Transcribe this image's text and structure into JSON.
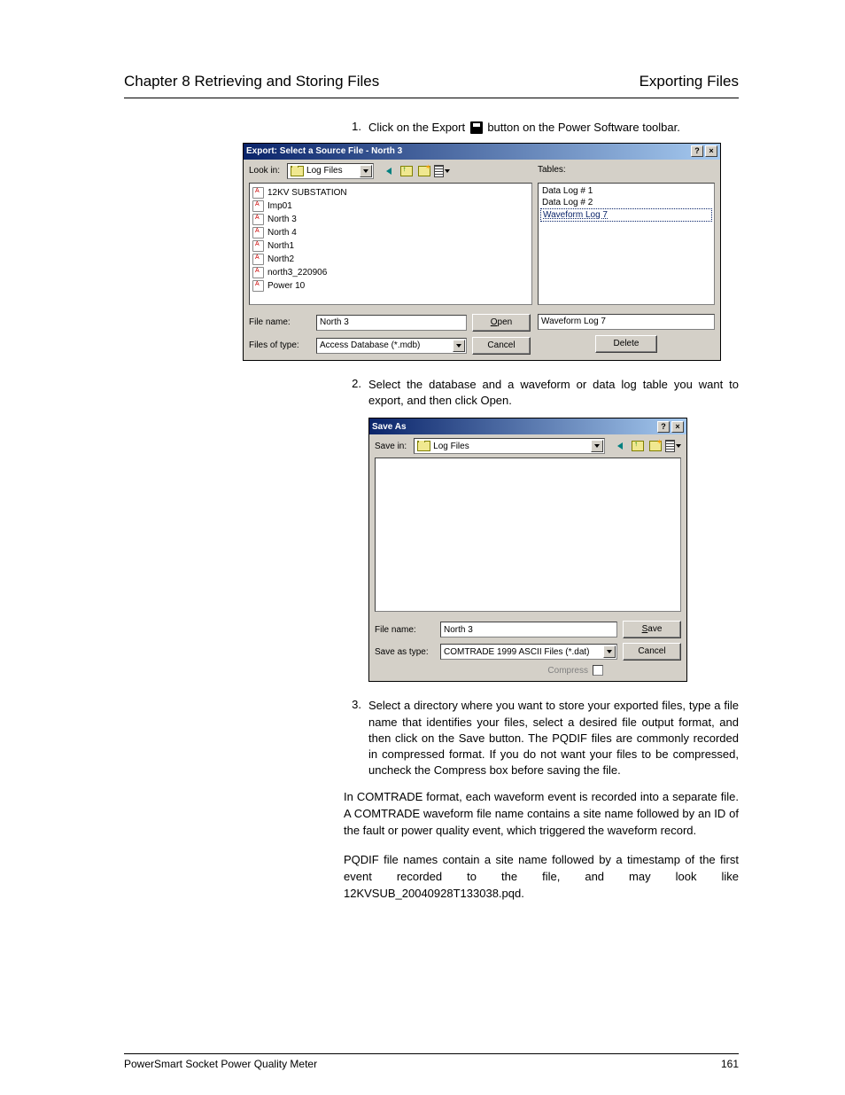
{
  "header": {
    "left": "Chapter 8 Retrieving and Storing Files",
    "right": "Exporting Files"
  },
  "steps": {
    "s1_num": "1.",
    "s1_text_a": "Click on the Export ",
    "s1_text_b": " button on the Power Software toolbar.",
    "s2_num": "2.",
    "s2_text": "Select the database and a waveform or data log table you want to export, and then click Open.",
    "s3_num": "3.",
    "s3_text": "Select a directory where you want to store your exported files, type a file name that identifies your files, select a desired file output format, and then click on the Save button. The PQDIF files are commonly recorded in compressed format. If you do not want your files to be compressed, uncheck the Compress box before saving the file."
  },
  "dialog1": {
    "title": "Export: Select a Source File - North 3",
    "lookin_label": "Look in:",
    "lookin_value": "Log Files",
    "files": [
      "12KV SUBSTATION",
      "Imp01",
      "North 3",
      "North 4",
      "North1",
      "North2",
      "north3_220906",
      "Power 10"
    ],
    "tables_label": "Tables:",
    "tables": [
      "Data Log # 1",
      "Data Log # 2",
      "Waveform Log 7"
    ],
    "filename_label": "File name:",
    "filename_value": "North 3",
    "filetype_label": "Files of type:",
    "filetype_value": "Access Database (*.mdb)",
    "open_btn": "Open",
    "cancel_btn": "Cancel",
    "selected_table": "Waveform Log 7",
    "delete_btn": "Delete"
  },
  "dialog2": {
    "title": "Save As",
    "savein_label": "Save in:",
    "savein_value": "Log Files",
    "filename_label": "File name:",
    "filename_value": "North 3",
    "saveastype_label": "Save as type:",
    "saveastype_value": "COMTRADE 1999 ASCII Files (*.dat)",
    "save_btn": "Save",
    "cancel_btn": "Cancel",
    "compress_label": "Compress"
  },
  "paragraphs": {
    "p1": "In COMTRADE format, each waveform event is recorded into a separate file. A COMTRADE waveform file name contains a site name followed by an ID of the fault or power quality event, which triggered the waveform record.",
    "p2": "PQDIF file names contain a site name followed by a timestamp of the first event recorded to the file, and may look like 12KVSUB_20040928T133038.pqd."
  },
  "footer": {
    "left": "PowerSmart Socket Power Quality Meter",
    "right": "161"
  }
}
